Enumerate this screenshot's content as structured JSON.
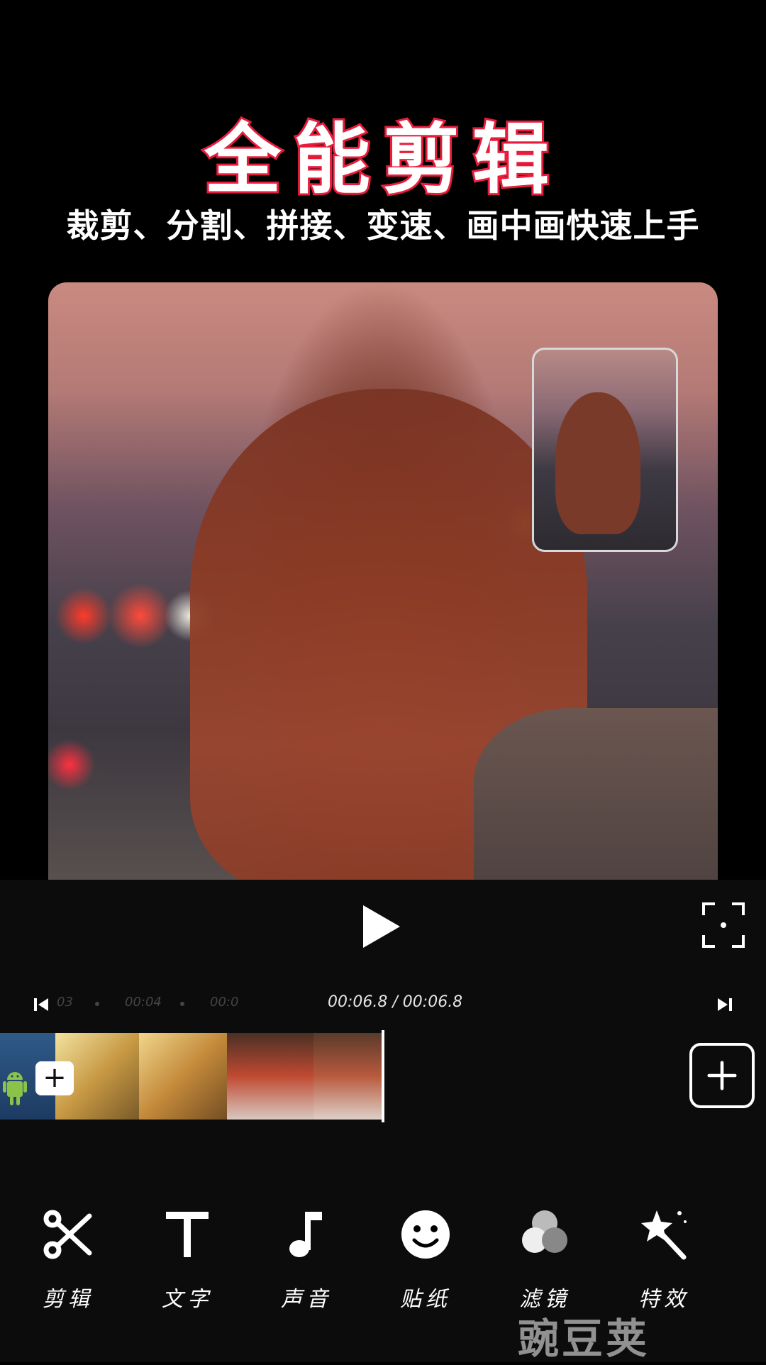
{
  "promo": {
    "headline": "全能剪辑",
    "subline": "裁剪、分割、拼接、变速、画中画快速上手"
  },
  "player": {
    "timeline_ticks": [
      "03",
      "00:04",
      "00:0"
    ],
    "timecode": "00:06.8 / 00:06.8"
  },
  "toolbar": {
    "items": [
      {
        "label": "剪辑",
        "icon": "scissors-icon"
      },
      {
        "label": "文字",
        "icon": "text-t-icon"
      },
      {
        "label": "声音",
        "icon": "music-note-icon"
      },
      {
        "label": "贴纸",
        "icon": "smiley-icon"
      },
      {
        "label": "滤镜",
        "icon": "filter-circles-icon"
      },
      {
        "label": "特效",
        "icon": "magic-wand-icon"
      }
    ]
  },
  "watermark": "豌豆荚",
  "colors": {
    "headline_stroke": "#e81e3c",
    "background": "#000000",
    "controls_bg": "#0c0c0c"
  }
}
